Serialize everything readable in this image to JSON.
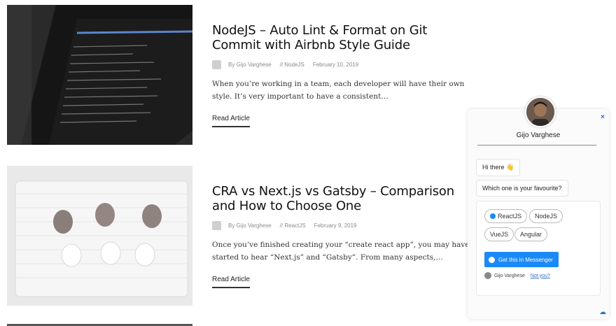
{
  "articles": [
    {
      "title": "NodeJS – Auto Lint & Format on Git Commit with Airbnb Style Guide",
      "author": "By Gijo Varghese",
      "category": "// NodeJS",
      "date": "February 10, 2019",
      "excerpt": "When you’re working in a team, each developer will have their own style. It’s very important to have a consistent…",
      "read_label": "Read Article"
    },
    {
      "title": "CRA vs Next.js vs Gatsby – Comparison and How to Choose One",
      "author": "By Gijo Varghese",
      "category": "// ReactJS",
      "date": "February 9, 2019",
      "excerpt": "Once you’ve finished creating your “create react app”, you may have started to hear “Next.js” and “Gatsby”. From many aspects,…",
      "read_label": "Read Article"
    }
  ],
  "chat": {
    "agent_name": "Gijo Varghese",
    "close_label": "×",
    "messages": [
      "Hi there 👋",
      "Which one is your favourite?"
    ],
    "quick_replies": [
      "ReactJS",
      "NodeJS",
      "VueJS",
      "Angular"
    ],
    "messenger_button": "Get this in Messenger",
    "user_name": "Gijo Varghese",
    "not_you": "Not you?",
    "accent_color": "#1b8af6"
  }
}
